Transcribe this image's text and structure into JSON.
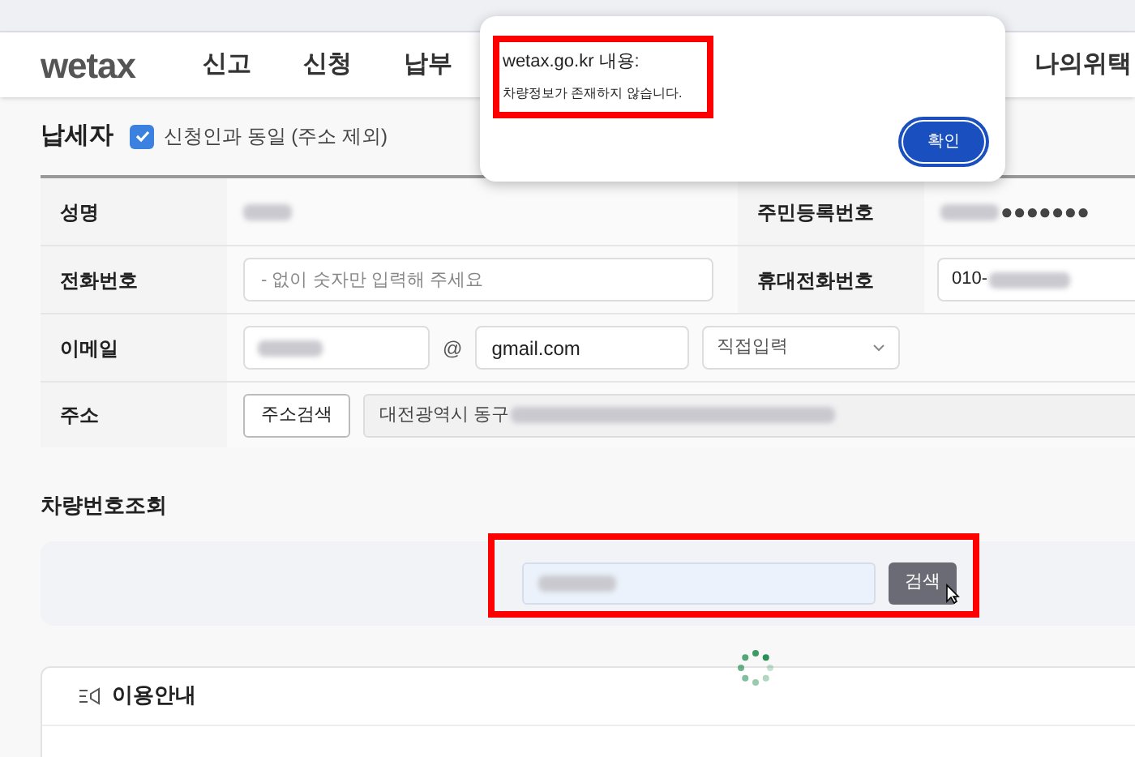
{
  "header": {
    "logo": "wetax",
    "nav": [
      {
        "label": "신고"
      },
      {
        "label": "신청"
      },
      {
        "label": "납부"
      },
      {
        "label": "나의위택"
      }
    ]
  },
  "taxpayer": {
    "title": "납세자",
    "same_as_applicant": {
      "label": "신청인과 동일 (주소 제외)",
      "checked": true
    },
    "rows": [
      {
        "label": "성명",
        "label_2": "주민등록번호",
        "masked_suffix": "●●●●●●●"
      },
      {
        "label": "전화번호",
        "placeholder": "- 없이 숫자만 입력해 주세요",
        "label_2": "휴대전화번호",
        "mobile_prefix": "010-"
      },
      {
        "label": "이메일",
        "at": "@",
        "domain": "gmail.com",
        "domain_select": "직접입력"
      },
      {
        "label": "주소",
        "button": "주소검색",
        "address": "대전광역시 동구"
      }
    ]
  },
  "vehicle_lookup": {
    "title": "차량번호조회",
    "search_button": "검색"
  },
  "guide": {
    "title": "이용안내"
  },
  "dialog": {
    "title": "wetax.go.kr 내용:",
    "message": "차량정보가 존재하지 않습니다.",
    "ok_button": "확인"
  }
}
